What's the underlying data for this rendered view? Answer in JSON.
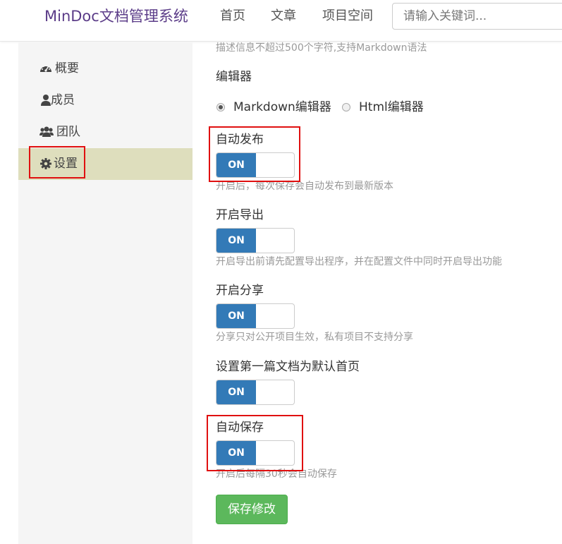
{
  "header": {
    "brand": "MinDoc文档管理系统",
    "nav": [
      "首页",
      "文章",
      "项目空间"
    ],
    "search_placeholder": "请输入关键词..."
  },
  "sidebar": {
    "items": [
      {
        "label": "概要",
        "icon": "dashboard-icon"
      },
      {
        "label": "成员",
        "icon": "user-icon"
      },
      {
        "label": "团队",
        "icon": "users-icon"
      },
      {
        "label": "设置",
        "icon": "gear-icon",
        "active": true
      }
    ]
  },
  "main": {
    "description_hint": "描述信息不超过500个字符,支持Markdown语法",
    "editor": {
      "label": "编辑器",
      "options": [
        {
          "label": "Markdown编辑器",
          "selected": true
        },
        {
          "label": "Html编辑器",
          "selected": false
        }
      ]
    },
    "settings": [
      {
        "label": "自动发布",
        "state": "ON",
        "hint": "开启后，每次保存会自动发布到最新版本"
      },
      {
        "label": "开启导出",
        "state": "ON",
        "hint": "开启导出前请先配置导出程序，并在配置文件中同时开启导出功能"
      },
      {
        "label": "开启分享",
        "state": "ON",
        "hint": "分享只对公开项目生效，私有项目不支持分享"
      },
      {
        "label": "设置第一篇文档为默认首页",
        "state": "ON",
        "hint": ""
      },
      {
        "label": "自动保存",
        "state": "ON",
        "hint": "开启后每隔30秒会自动保存"
      }
    ],
    "save_button": "保存修改"
  },
  "colors": {
    "brand": "#5b3c88",
    "switch_on": "#337ab7",
    "save_button": "#5cb85c",
    "active_sidebar": "#dedebd",
    "highlight_box": "#e01010"
  }
}
